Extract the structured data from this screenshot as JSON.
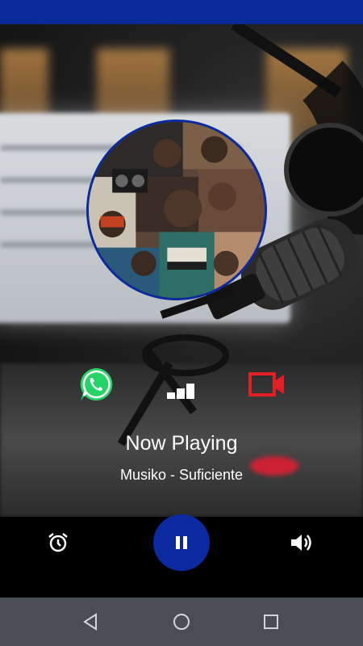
{
  "app": {
    "status_bar_color": "#0a2a9a",
    "accent_color": "#0b2a9f"
  },
  "actions": {
    "whatsapp_icon": "whatsapp-icon",
    "whatsapp_color": "#25d366",
    "signal_icon": "signal-bars-icon",
    "video_icon": "video-camera-icon",
    "video_color": "#e01f26"
  },
  "player": {
    "heading": "Now Playing",
    "track": "Musiko - Suficiente",
    "state": "playing"
  },
  "controls": {
    "alarm_icon": "alarm-clock-icon",
    "pause_icon": "pause-icon",
    "volume_icon": "volume-icon"
  },
  "navbar": {
    "back_icon": "back-triangle-icon",
    "home_icon": "home-circle-icon",
    "recents_icon": "recents-square-icon"
  }
}
